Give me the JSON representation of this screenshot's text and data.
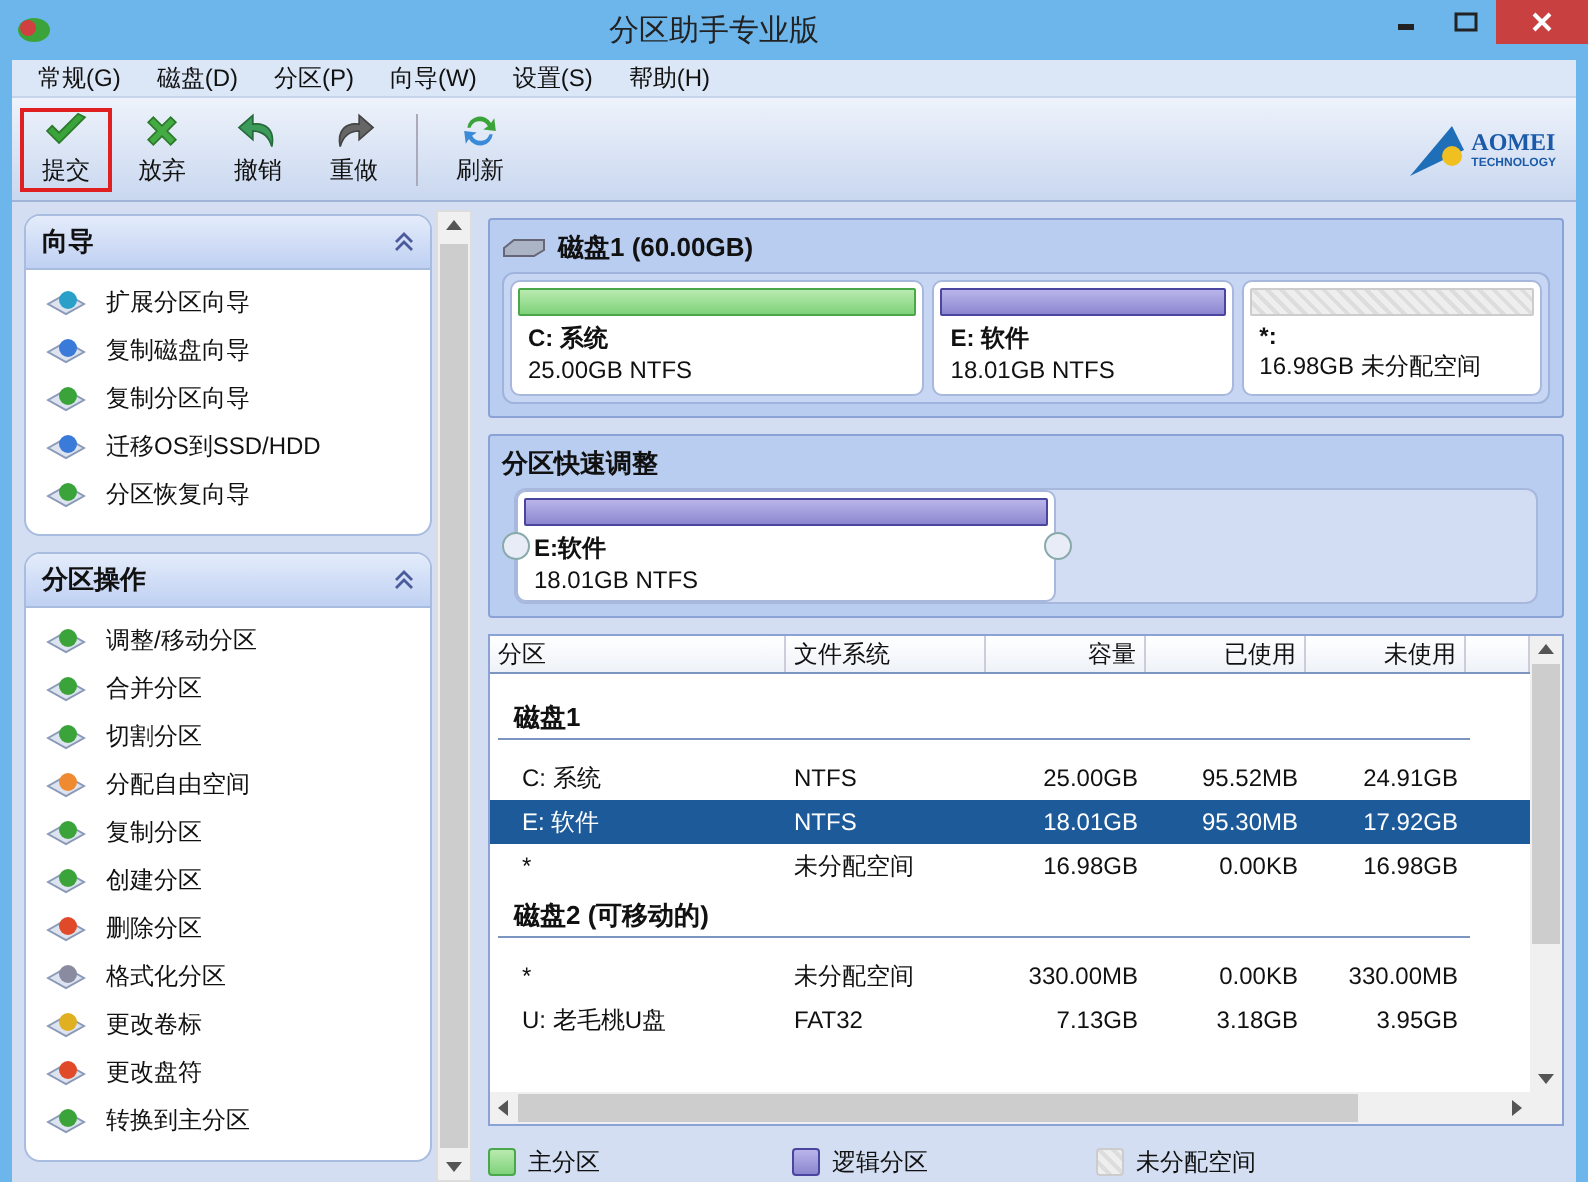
{
  "window": {
    "title": "分区助手专业版"
  },
  "menu": [
    "常规(G)",
    "磁盘(D)",
    "分区(P)",
    "向导(W)",
    "设置(S)",
    "帮助(H)"
  ],
  "toolbar": [
    {
      "label": "提交",
      "highlighted": true
    },
    {
      "label": "放弃",
      "highlighted": false
    },
    {
      "label": "撤销",
      "highlighted": false
    },
    {
      "label": "重做",
      "highlighted": false
    },
    {
      "label": "刷新",
      "highlighted": false
    }
  ],
  "logo": {
    "name": "AOMEI",
    "tagline": "TECHNOLOGY"
  },
  "sidebar": [
    {
      "title": "向导",
      "items": [
        "扩展分区向导",
        "复制磁盘向导",
        "复制分区向导",
        "迁移OS到SSD/HDD",
        "分区恢复向导"
      ]
    },
    {
      "title": "分区操作",
      "items": [
        "调整/移动分区",
        "合并分区",
        "切割分区",
        "分配自由空间",
        "复制分区",
        "创建分区",
        "删除分区",
        "格式化分区",
        "更改卷标",
        "更改盘符",
        "转换到主分区"
      ]
    }
  ],
  "disk": {
    "title": "磁盘1 (60.00GB)",
    "partitions": [
      {
        "kind": "primary",
        "name": "C: 系统",
        "info": "25.00GB NTFS"
      },
      {
        "kind": "logical",
        "name": "E: 软件",
        "info": "18.01GB NTFS"
      },
      {
        "kind": "unallocated",
        "name": "*:",
        "info": "16.98GB 未分配空间"
      }
    ]
  },
  "quick_resize": {
    "title": "分区快速调整",
    "partition": {
      "kind": "logical",
      "name": "E:软件",
      "info": "18.01GB NTFS"
    }
  },
  "table": {
    "columns": [
      "分区",
      "文件系统",
      "容量",
      "已使用",
      "未使用"
    ],
    "rows": [
      {
        "kind": "group",
        "label": "磁盘1"
      },
      {
        "kind": "row",
        "selected": false,
        "cells": [
          "C: 系统",
          "NTFS",
          "25.00GB",
          "95.52MB",
          "24.91GB"
        ]
      },
      {
        "kind": "row",
        "selected": true,
        "cells": [
          "E: 软件",
          "NTFS",
          "18.01GB",
          "95.30MB",
          "17.92GB"
        ]
      },
      {
        "kind": "row",
        "selected": false,
        "cells": [
          "*",
          "未分配空间",
          "16.98GB",
          "0.00KB",
          "16.98GB"
        ]
      },
      {
        "kind": "group",
        "label": "磁盘2 (可移动的)"
      },
      {
        "kind": "row",
        "selected": false,
        "cells": [
          "*",
          "未分配空间",
          "330.00MB",
          "0.00KB",
          "330.00MB"
        ]
      },
      {
        "kind": "row",
        "selected": false,
        "cells": [
          "U: 老毛桃U盘",
          "FAT32",
          "7.13GB",
          "3.18GB",
          "3.95GB"
        ]
      }
    ]
  },
  "legend": [
    {
      "kind": "primary",
      "label": "主分区"
    },
    {
      "kind": "logical",
      "label": "逻辑分区"
    },
    {
      "kind": "unallocated",
      "label": "未分配空间"
    }
  ]
}
